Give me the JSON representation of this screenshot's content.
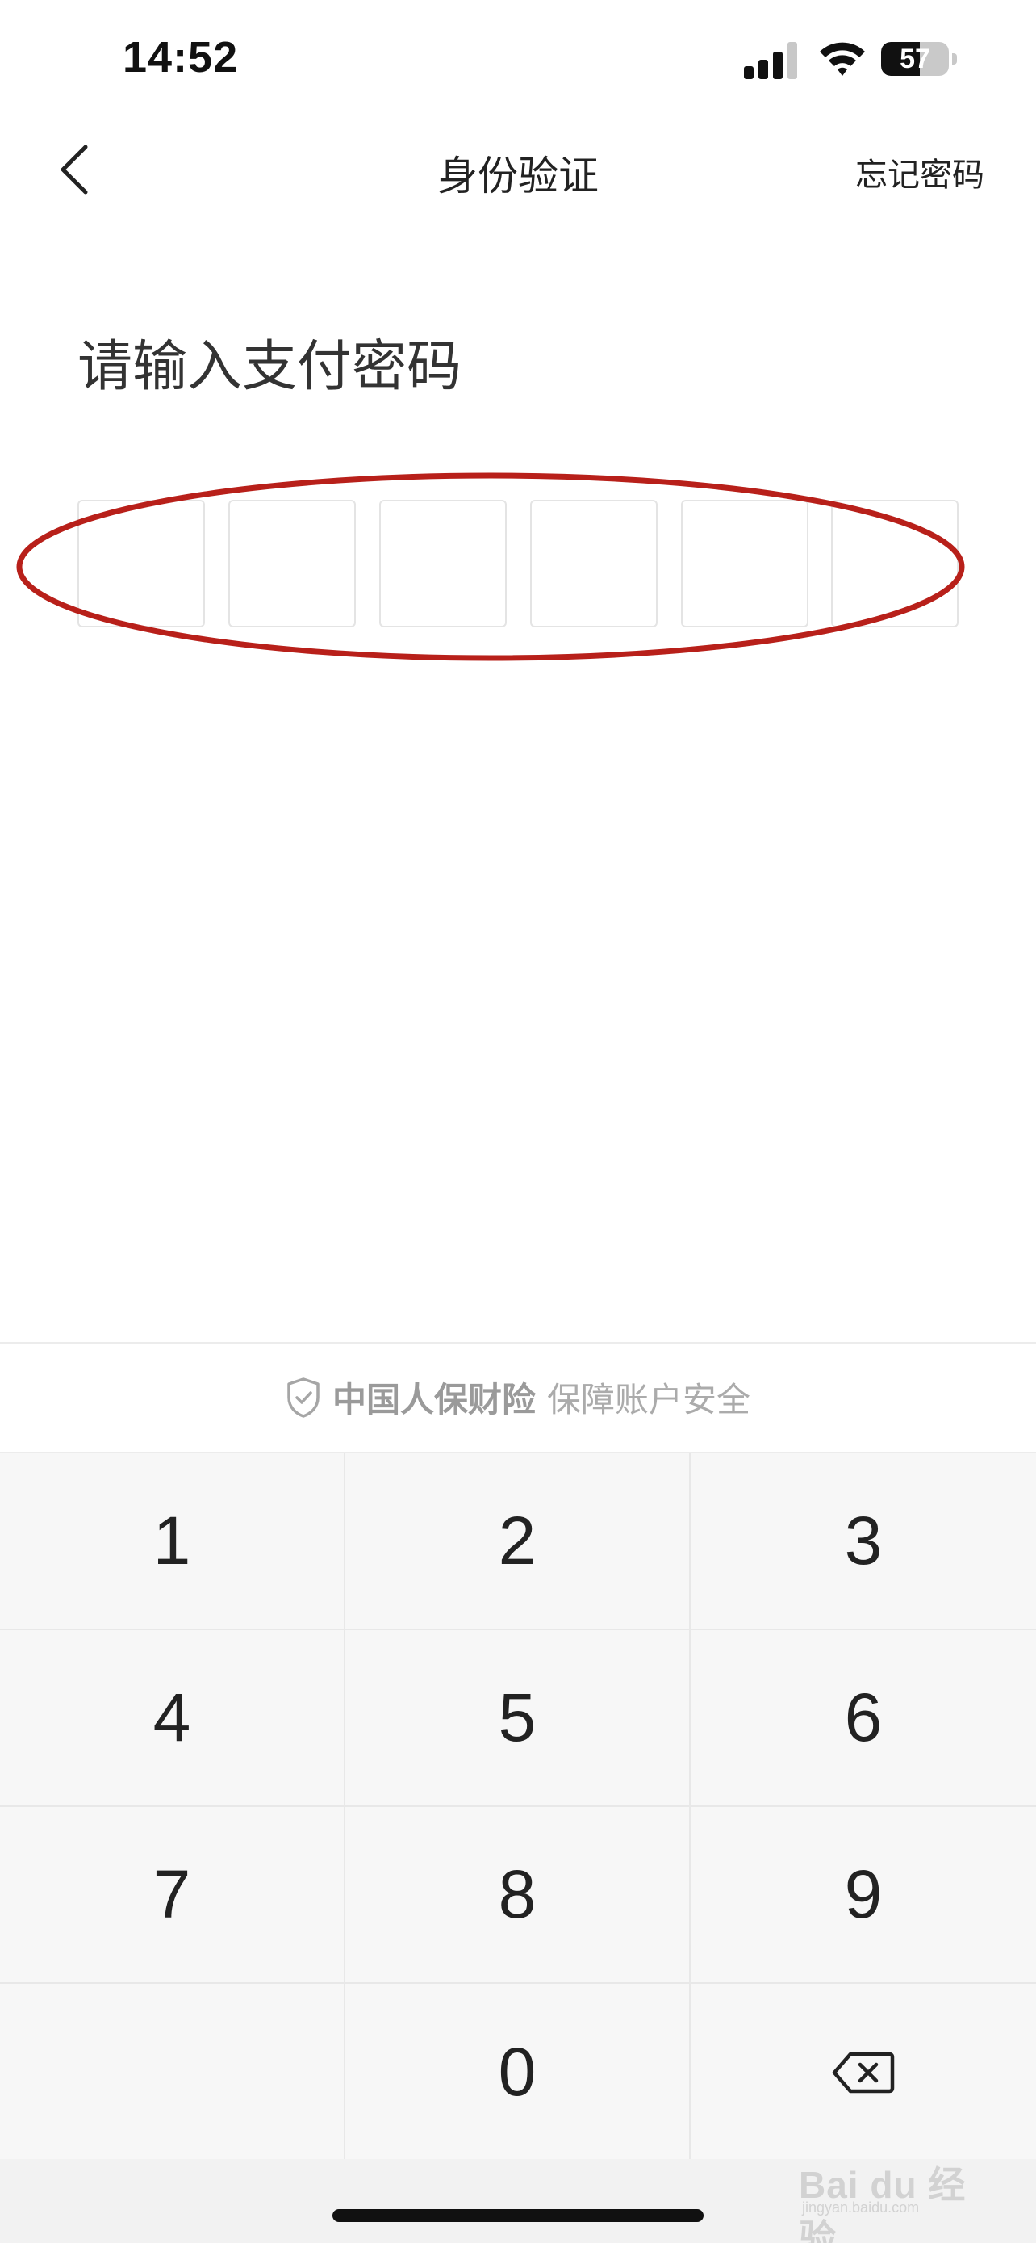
{
  "status_bar": {
    "time": "14:52",
    "battery_percent": "57",
    "battery_level": 0.57,
    "icons": [
      "signal-icon",
      "wifi-icon",
      "battery-icon"
    ]
  },
  "nav": {
    "back_icon": "chevron-left-icon",
    "title": "身份验证",
    "forgot_label": "忘记密码"
  },
  "prompt": "请输入支付密码",
  "pin": {
    "length": 6,
    "filled": 0,
    "annotation_color": "#b8201a"
  },
  "banner": {
    "icon": "shield-check-icon",
    "brand": "中国人保财险",
    "slogan": "保障账户安全"
  },
  "keypad": {
    "keys": [
      "1",
      "2",
      "3",
      "4",
      "5",
      "6",
      "7",
      "8",
      "9",
      "",
      "0",
      "delete"
    ],
    "delete_icon": "backspace-icon"
  },
  "watermark": {
    "main": "Bai du 经验",
    "sub": "jingyan.baidu.com"
  }
}
